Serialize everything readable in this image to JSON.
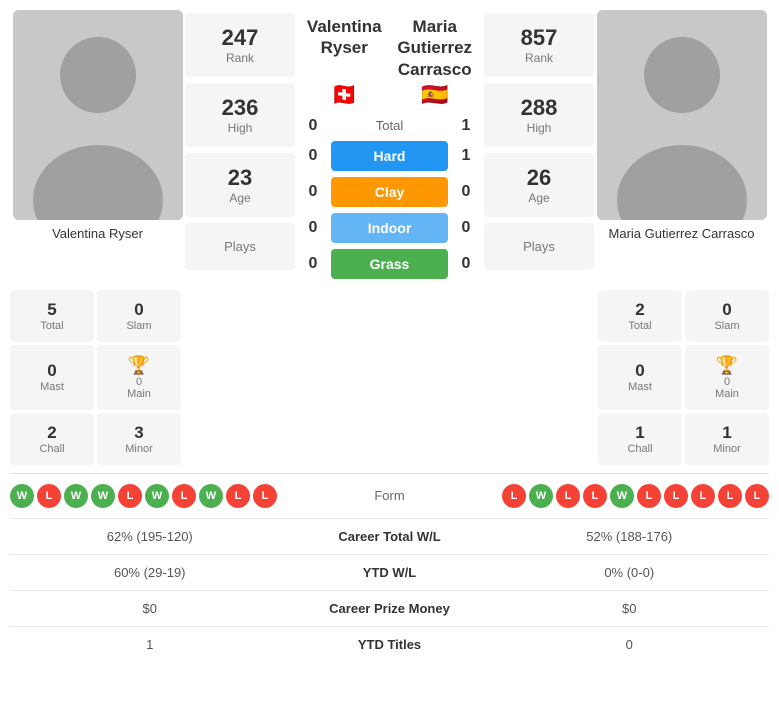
{
  "players": {
    "left": {
      "name": "Valentina Ryser",
      "flag": "🇨🇭",
      "rank": {
        "value": "247",
        "label": "Rank"
      },
      "high": {
        "value": "236",
        "label": "High"
      },
      "age": {
        "value": "23",
        "label": "Age"
      },
      "plays": {
        "label": "Plays"
      },
      "total": {
        "value": "5",
        "label": "Total"
      },
      "slam": {
        "value": "0",
        "label": "Slam"
      },
      "mast": {
        "value": "0",
        "label": "Mast"
      },
      "main": {
        "value": "0",
        "label": "Main"
      },
      "chall": {
        "value": "2",
        "label": "Chall"
      },
      "minor": {
        "value": "3",
        "label": "Minor"
      }
    },
    "right": {
      "name": "Maria Gutierrez Carrasco",
      "flag": "🇪🇸",
      "rank": {
        "value": "857",
        "label": "Rank"
      },
      "high": {
        "value": "288",
        "label": "High"
      },
      "age": {
        "value": "26",
        "label": "Age"
      },
      "plays": {
        "label": "Plays"
      },
      "total": {
        "value": "2",
        "label": "Total"
      },
      "slam": {
        "value": "0",
        "label": "Slam"
      },
      "mast": {
        "value": "0",
        "label": "Mast"
      },
      "main": {
        "value": "0",
        "label": "Main"
      },
      "chall": {
        "value": "1",
        "label": "Chall"
      },
      "minor": {
        "value": "1",
        "label": "Minor"
      }
    }
  },
  "courts": {
    "total": {
      "label": "Total",
      "left_score": "0",
      "right_score": "1"
    },
    "hard": {
      "label": "Hard",
      "left_score": "0",
      "right_score": "1"
    },
    "clay": {
      "label": "Clay",
      "left_score": "0",
      "right_score": "0"
    },
    "indoor": {
      "label": "Indoor",
      "left_score": "0",
      "right_score": "0"
    },
    "grass": {
      "label": "Grass",
      "left_score": "0",
      "right_score": "0"
    }
  },
  "form": {
    "label": "Form",
    "left": [
      "W",
      "L",
      "W",
      "W",
      "L",
      "W",
      "L",
      "W",
      "L",
      "L"
    ],
    "right": [
      "L",
      "W",
      "L",
      "L",
      "W",
      "L",
      "L",
      "L",
      "L",
      "L"
    ]
  },
  "stats": [
    {
      "label": "Career Total W/L",
      "left": "62% (195-120)",
      "right": "52% (188-176)"
    },
    {
      "label": "YTD W/L",
      "left": "60% (29-19)",
      "right": "0% (0-0)"
    },
    {
      "label": "Career Prize Money",
      "left": "$0",
      "right": "$0"
    },
    {
      "label": "YTD Titles",
      "left": "1",
      "right": "0"
    }
  ]
}
